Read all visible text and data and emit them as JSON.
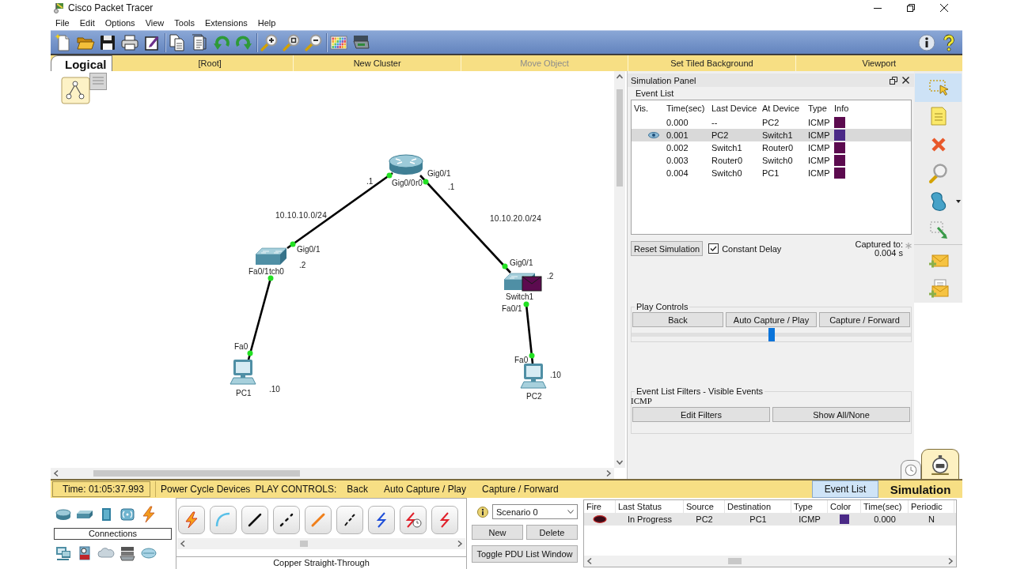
{
  "window": {
    "title": "Cisco Packet Tracer"
  },
  "menu": [
    "File",
    "Edit",
    "Options",
    "View",
    "Tools",
    "Extensions",
    "Help"
  ],
  "workspace_bar": {
    "tab": "Logical",
    "items": [
      {
        "label": "[Root]",
        "disabled": false
      },
      {
        "label": "New Cluster",
        "disabled": false
      },
      {
        "label": "Move Object",
        "disabled": true
      },
      {
        "label": "Set Tiled Background",
        "disabled": false
      },
      {
        "label": "Viewport",
        "disabled": false
      }
    ]
  },
  "topology": {
    "devices": [
      {
        "kind": "router",
        "label": "r0"
      },
      {
        "kind": "switch",
        "label": "tch0"
      },
      {
        "kind": "switch",
        "label": "Switch1"
      },
      {
        "kind": "pc",
        "label": "PC1"
      },
      {
        "kind": "pc",
        "label": "PC2"
      }
    ],
    "links": [
      {
        "up": true
      },
      {
        "up": true
      },
      {
        "up": true
      },
      {
        "up": true
      }
    ],
    "labels": [
      {
        "kind": "port",
        "text": "Gig0/0"
      },
      {
        "kind": "port",
        "text": "Gig0/1"
      },
      {
        "kind": "address",
        "text": ".1"
      },
      {
        "kind": "address",
        "text": ".1"
      },
      {
        "kind": "network",
        "text": "10.10.10.0/24"
      },
      {
        "kind": "network",
        "text": "10.10.20.0/24"
      },
      {
        "kind": "port",
        "text": "Gig0/1"
      },
      {
        "kind": "address",
        "text": ".2"
      },
      {
        "kind": "port",
        "text": "Fa0/1"
      },
      {
        "kind": "port",
        "text": "Fa0"
      },
      {
        "kind": "address",
        "text": ".10"
      },
      {
        "kind": "port",
        "text": "Gig0/1"
      },
      {
        "kind": "address",
        "text": ".2"
      },
      {
        "kind": "port",
        "text": "Fa0/1"
      },
      {
        "kind": "port",
        "text": "Fa0"
      },
      {
        "kind": "address",
        "text": ".10"
      }
    ]
  },
  "simulation_panel": {
    "title": "Simulation Panel",
    "event_list": {
      "label": "Event List",
      "columns": [
        "Vis.",
        "Time(sec)",
        "Last Device",
        "At Device",
        "Type",
        "Info"
      ],
      "rows": [
        {
          "time": "0.000",
          "last_device": "--",
          "at_device": "PC2",
          "type": "ICMP",
          "color": "#5c0b4f",
          "selected": false,
          "current": false
        },
        {
          "time": "0.001",
          "last_device": "PC2",
          "at_device": "Switch1",
          "type": "ICMP",
          "color": "#4b2a87",
          "selected": true,
          "current": true
        },
        {
          "time": "0.002",
          "last_device": "Switch1",
          "at_device": "Router0",
          "type": "ICMP",
          "color": "#5c0b4f",
          "selected": false,
          "current": false
        },
        {
          "time": "0.003",
          "last_device": "Router0",
          "at_device": "Switch0",
          "type": "ICMP",
          "color": "#5c0b4f",
          "selected": false,
          "current": false
        },
        {
          "time": "0.004",
          "last_device": "Switch0",
          "at_device": "PC1",
          "type": "ICMP",
          "color": "#5c0b4f",
          "selected": false,
          "current": false
        }
      ]
    },
    "reset_button": "Reset Simulation",
    "constant_delay": {
      "label": "Constant Delay",
      "checked": true
    },
    "captured_label": "Captured to:",
    "captured_value": "0.004 s",
    "play_controls": {
      "label": "Play Controls",
      "buttons": [
        "Back",
        "Auto Capture / Play",
        "Capture / Forward"
      ],
      "level": 0.5
    },
    "filters": {
      "label": "Event List Filters - Visible Events",
      "visible": "ICMP",
      "buttons": [
        "Edit Filters",
        "Show All/None"
      ]
    }
  },
  "tools": [
    {
      "selected": true
    },
    {
      "selected": false
    },
    {
      "selected": false
    },
    {
      "selected": false
    },
    {
      "selected": false
    },
    {
      "selected": false
    },
    {
      "selected": false
    },
    {
      "selected": false
    }
  ],
  "mode_tabs": [
    {
      "selected": false
    },
    {
      "selected": true
    }
  ],
  "status_bar": {
    "time": "Time: 01:05:37.993",
    "power_cycle": "Power Cycle Devices",
    "play_label": "PLAY CONTROLS:",
    "play_buttons": [
      "Back",
      "Auto Capture / Play",
      "Capture / Forward"
    ],
    "event_list": {
      "label": "Event List",
      "selected": true
    },
    "mode": "Simulation"
  },
  "device_panel": {
    "category": "Connections"
  },
  "connections_panel": {
    "caption": "Copper Straight-Through"
  },
  "scenario": {
    "value": "Scenario 0",
    "buttons": [
      "New",
      "Delete"
    ],
    "toggle": "Toggle PDU List Window"
  },
  "pdu_list": {
    "columns": [
      "Fire",
      "Last Status",
      "Source",
      "Destination",
      "Type",
      "Color",
      "Time(sec)",
      "Periodic"
    ],
    "rows": [
      {
        "last_status": "In Progress",
        "source": "PC2",
        "destination": "PC1",
        "type": "ICMP",
        "color": "#4b2a87",
        "time": "0.000",
        "periodic": "N"
      }
    ]
  }
}
